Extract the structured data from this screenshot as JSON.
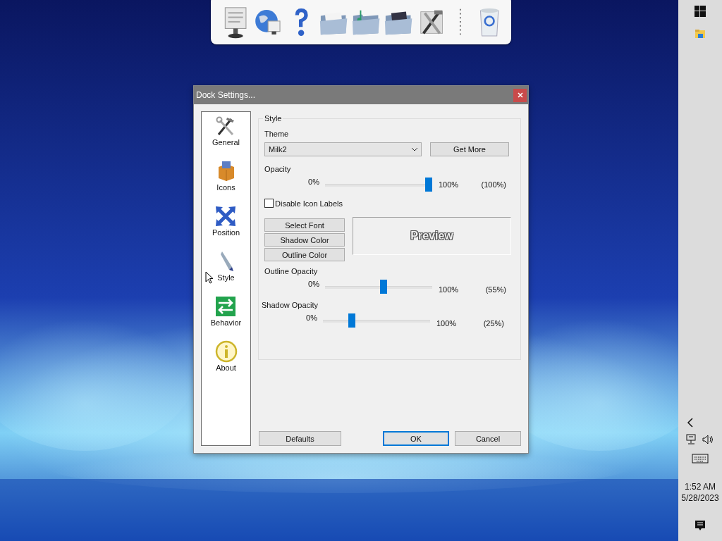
{
  "dialog": {
    "title": "Dock Settings...",
    "sidebar": {
      "items": [
        {
          "label": "General"
        },
        {
          "label": "Icons"
        },
        {
          "label": "Position"
        },
        {
          "label": "Style"
        },
        {
          "label": "Behavior"
        },
        {
          "label": "About"
        }
      ]
    },
    "style_group": {
      "legend": "Style",
      "theme_label": "Theme",
      "theme_value": "Milk2",
      "get_more": "Get More",
      "opacity": {
        "label": "Opacity",
        "min": "0%",
        "max": "100%",
        "reading": "(100%)",
        "level": 1.0
      },
      "disable_labels": {
        "label": "Disable Icon Labels",
        "checked": false
      },
      "font_buttons": [
        "Select Font",
        "Shadow Color",
        "Outline Color"
      ],
      "preview": "Preview",
      "sliders": [
        {
          "label": "Outline Opacity",
          "min": "0%",
          "max": "100%",
          "reading": "(55%)",
          "level": 0.55
        },
        {
          "label": "Shadow Opacity",
          "min": "0%",
          "max": "100%",
          "reading": "(25%)",
          "level": 0.25
        }
      ]
    },
    "buttons": [
      {
        "label": "Defaults",
        "default": false
      },
      {
        "label": "OK",
        "default": true
      },
      {
        "label": "Cancel",
        "default": false
      }
    ]
  },
  "taskbar": {
    "time": "1:52 AM",
    "date": "5/28/2023"
  }
}
